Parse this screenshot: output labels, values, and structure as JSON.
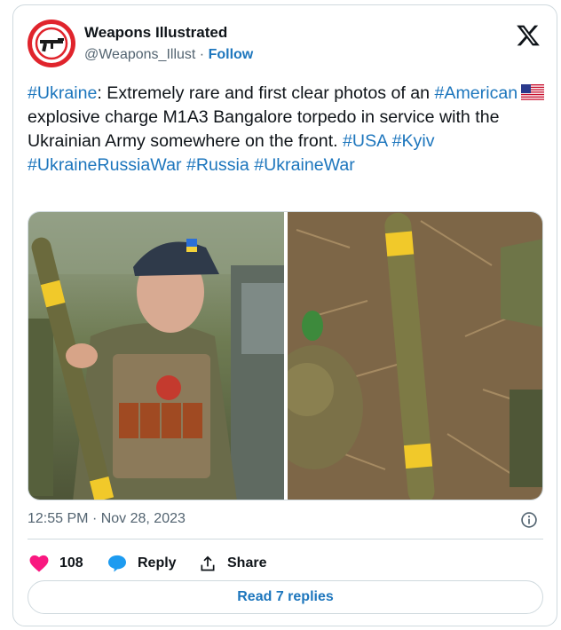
{
  "author": {
    "display_name": "Weapons Illustrated",
    "handle": "@Weapons_Illust",
    "separator": "·",
    "follow_label": "Follow"
  },
  "tweet": {
    "segments": [
      {
        "text": "#Ukraine",
        "type": "hashtag"
      },
      {
        "text": ": Extremely rare and first clear photos of an ",
        "type": "text"
      },
      {
        "text": "#American",
        "type": "hashtag"
      },
      {
        "text": "",
        "type": "flag-us"
      },
      {
        "text": "explosive charge M1A3 Bangalore torpedo in service with the Ukrainian Army somewhere on the front. ",
        "type": "text"
      },
      {
        "text": "#USA",
        "type": "hashtag"
      },
      {
        "text": " ",
        "type": "text"
      },
      {
        "text": "#Kyiv",
        "type": "hashtag"
      },
      {
        "text": " ",
        "type": "text"
      },
      {
        "text": "#UkraineRussiaWar",
        "type": "hashtag"
      },
      {
        "text": " ",
        "type": "text"
      },
      {
        "text": "#Russia",
        "type": "hashtag"
      },
      {
        "text": " ",
        "type": "text"
      },
      {
        "text": "#UkraineWar",
        "type": "hashtag"
      }
    ]
  },
  "media": {
    "photos": [
      "soldier-holding-bangalore-torpedo",
      "bangalore-torpedo-on-ground"
    ]
  },
  "meta": {
    "time": "12:55 PM",
    "separator": "·",
    "date": "Nov 28, 2023"
  },
  "actions": {
    "like_count": "108",
    "reply_label": "Reply",
    "share_label": "Share"
  },
  "read_replies_label": "Read 7 replies",
  "colors": {
    "link": "#1d76bd",
    "like": "#f91880",
    "reply": "#1d9bf0",
    "secondary_text": "#536471",
    "border": "#cfd9de",
    "avatar_ring": "#e0242c"
  }
}
